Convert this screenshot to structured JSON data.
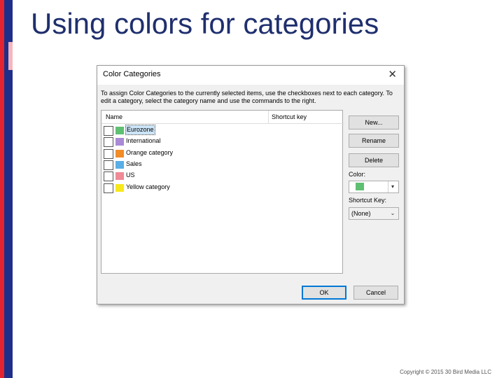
{
  "slide": {
    "title": "Using colors for categories",
    "copyright": "Copyright © 2015 30 Bird Media LLC"
  },
  "dialog": {
    "title": "Color Categories",
    "instructions": "To assign Color Categories to the currently selected items, use the checkboxes next to each category.  To edit a category, select the category name and use the commands to the right.",
    "columns": {
      "name": "Name",
      "shortcut": "Shortcut key"
    },
    "categories": [
      {
        "label": "Eurozone",
        "color": "#5fbf72",
        "checked": false,
        "selected": true
      },
      {
        "label": "International",
        "color": "#a98ad6",
        "checked": false,
        "selected": false
      },
      {
        "label": "Orange category",
        "color": "#f28c28",
        "checked": false,
        "selected": false
      },
      {
        "label": "Sales",
        "color": "#5aaee5",
        "checked": false,
        "selected": false
      },
      {
        "label": "US",
        "color": "#ef8a96",
        "checked": false,
        "selected": false
      },
      {
        "label": "Yellow category",
        "color": "#f7e81c",
        "checked": false,
        "selected": false
      }
    ],
    "buttons": {
      "new": "New...",
      "rename": "Rename",
      "delete": "Delete",
      "ok": "OK",
      "cancel": "Cancel"
    },
    "color_label": "Color:",
    "color_value": "#5fbf72",
    "shortcut_label": "Shortcut Key:",
    "shortcut_value": "(None)"
  },
  "colors": {
    "title": "#1f2f6e",
    "bar_red": "#e4242e",
    "bar_navy": "#1e2f8a"
  }
}
